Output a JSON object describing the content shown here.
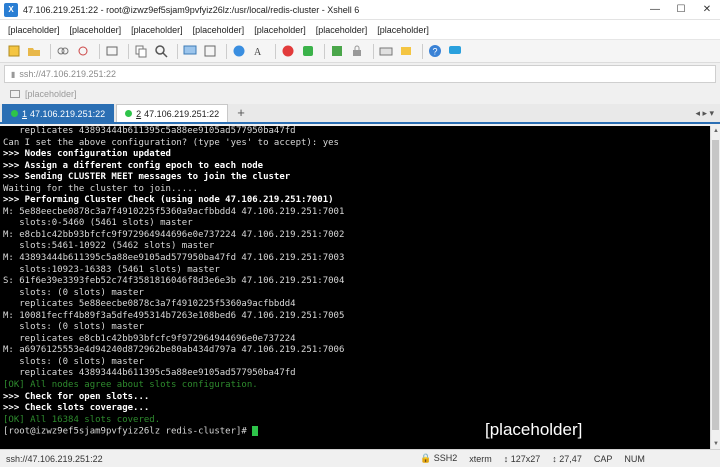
{
  "window": {
    "title": "47.106.219.251:22 - root@izwz9ef5sjam9pvfyiz26lz:/usr/local/redis-cluster - Xshell 6",
    "minimize": "—",
    "maximize": "☐",
    "close": "✕"
  },
  "menu": [
    {
      "label": "[placeholder]"
    },
    {
      "label": "[placeholder]"
    },
    {
      "label": "[placeholder]"
    },
    {
      "label": "[placeholder]"
    },
    {
      "label": "[placeholder]"
    },
    {
      "label": "[placeholder]"
    },
    {
      "label": "[placeholder]"
    }
  ],
  "address": {
    "value": "ssh://47.106.219.251:22"
  },
  "hint": {
    "text": "[placeholder]"
  },
  "tabs": [
    {
      "number": "1",
      "label": "47.106.219.251:22"
    },
    {
      "number": "2",
      "label": "47.106.219.251:22"
    }
  ],
  "tab_add": "+",
  "terminal": {
    "lines": [
      "   replicates 43893444b611395c5a88ee9105ad577950ba47fd",
      "Can I set the above configuration? (type 'yes' to accept): yes",
      ">>> Nodes configuration updated",
      ">>> Assign a different config epoch to each node",
      ">>> Sending CLUSTER MEET messages to join the cluster",
      "Waiting for the cluster to join.....",
      ">>> Performing Cluster Check (using node 47.106.219.251:7001)",
      "M: 5e88eecbe0878c3a7f4910225f5360a9acfbbdd4 47.106.219.251:7001",
      "   slots:0-5460 (5461 slots) master",
      "M: e8cb1c42bb93bfcfc9f972964944696e0e737224 47.106.219.251:7002",
      "   slots:5461-10922 (5462 slots) master",
      "M: 43893444b611395c5a88ee9105ad577950ba47fd 47.106.219.251:7003",
      "   slots:10923-16383 (5461 slots) master",
      "S: 61f6e39e3393feb52c74f3581816046f8d3e6e3b 47.106.219.251:7004",
      "   slots: (0 slots) master",
      "   replicates 5e88eecbe0878c3a7f4910225f5360a9acfbbdd4",
      "M: 10081fecff4b89f3a5dfe495314b7263e108bed6 47.106.219.251:7005",
      "   slots: (0 slots) master",
      "   replicates e8cb1c42bb93bfcfc9f972964944696e0e737224",
      "M: a6976125553e4d94240d872962be80ab434d797a 47.106.219.251:7006",
      "   slots: (0 slots) master",
      "   replicates 43893444b611395c5a88ee9105ad577950ba47fd",
      "[OK] All nodes agree about slots configuration.",
      ">>> Check for open slots...",
      ">>> Check slots coverage...",
      "[OK] All 16384 slots covered."
    ],
    "prompt": "[root@izwz9ef5sjam9pvfyiz26lz redis-cluster]# "
  },
  "watermark": "[placeholder]",
  "status": {
    "session": "ssh://47.106.219.251:22",
    "protocol": "SSH2",
    "terminal_type": "xterm",
    "size": "127x27",
    "position": "27,47",
    "cap": "CAP",
    "num": "NUM"
  },
  "colors": {
    "terminal_bg": "#000000",
    "terminal_fg": "#d8d8d8",
    "ok_green": "#2e8b2e",
    "cursor": "#2ec44a",
    "active_tab": "#2b6fb4"
  }
}
